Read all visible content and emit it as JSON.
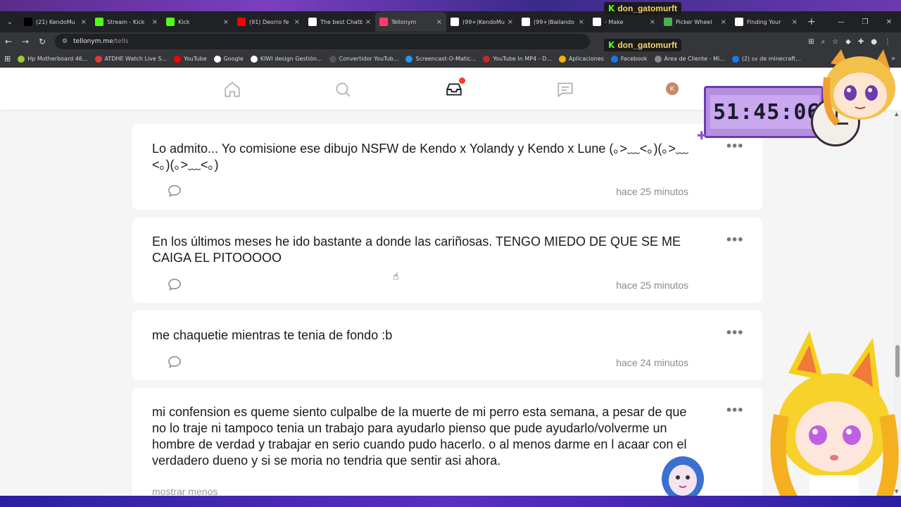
{
  "browser": {
    "tabs": [
      {
        "label": "(21) KendoMu",
        "icon": "x-logo-icon",
        "color": "#000000"
      },
      {
        "label": "Stream - Kick",
        "icon": "kick-logo-icon",
        "color": "#53fc18"
      },
      {
        "label": "Kick",
        "icon": "kick-logo-icon",
        "color": "#53fc18"
      },
      {
        "label": "(91) Deorro fe",
        "icon": "youtube-icon",
        "color": "#ff0000"
      },
      {
        "label": "The best Chatb",
        "icon": "diamond-icon",
        "color": "#ffffff"
      },
      {
        "label": "Tellonym",
        "icon": "tellonym-icon",
        "color": "#ff3c6a"
      },
      {
        "label": "(99+)KendoMu",
        "icon": "tiktok-icon",
        "color": "#ffffff"
      },
      {
        "label": "(99+)Bailando",
        "icon": "tiktok-icon",
        "color": "#ffffff"
      },
      {
        "label": "- Make",
        "icon": "tiktok-icon",
        "color": "#ffffff"
      },
      {
        "label": "Picker Wheel",
        "icon": "wheel-icon",
        "color": "#4caf50"
      },
      {
        "label": "Finding Your",
        "icon": "tiktok-icon",
        "color": "#ffffff"
      }
    ],
    "url_host": "tellonym.me",
    "url_path": "/tells",
    "bookmarks": [
      {
        "label": "Hp Motherboard 46...",
        "color": "#9acd32"
      },
      {
        "label": "ATDHE Watch Live S...",
        "color": "#e53935"
      },
      {
        "label": "YouTube",
        "color": "#ff0000"
      },
      {
        "label": "Google",
        "color": "#ffffff"
      },
      {
        "label": "KIWI design Gestión...",
        "color": "#ffffff"
      },
      {
        "label": "Convertidor YouTub...",
        "color": "#555555"
      },
      {
        "label": "Screencast-O-Matic...",
        "color": "#2196f3"
      },
      {
        "label": "YouTube In MP4 - D...",
        "color": "#c62828"
      },
      {
        "label": "Aplicaciones",
        "color": "#f4b400"
      },
      {
        "label": "Facebook",
        "color": "#1877f2"
      },
      {
        "label": "Área de Cliente - Mi...",
        "color": "#888888"
      },
      {
        "label": "(2) sv de minecraft...",
        "color": "#1877f2"
      }
    ]
  },
  "nav": {
    "avatar_initial": "K",
    "notification_color": "#ff3b30"
  },
  "tells": [
    {
      "text": "Lo admito... Yo comisione ese dibujo NSFW de Kendo x Yolandy y Kendo x Lune (｡>﹏<｡)(｡>﹏<｡)(｡>﹏<｡)",
      "time": "hace 25 minutos"
    },
    {
      "text": "En los últimos meses he ido bastante a donde las cariñosas. TENGO MIEDO DE QUE SE ME CAIGA EL PITOOOOO",
      "time": "hace 25 minutos"
    },
    {
      "text": "me chaquetie mientras te tenia de fondo :b",
      "time": "hace 24 minutos"
    },
    {
      "text": "mi confension es queme siento culpalbe  de la muerte de mi perro esta semana, a pesar de que no lo traje ni tampoco tenia un trabajo para ayudarlo pienso que pude ayudarlo/volverme un hombre de verdad y trabajar en serio cuando pudo hacerlo. o al menos darme en l acaar con el verdadero dueno y si se moria no tendria que sentir asi ahora.",
      "more_label": "mostrar menos"
    }
  ],
  "overlay": {
    "timer": "51:45:06",
    "kick_user_1": "don_gatomurft",
    "kick_user_2": "don_gatomurft"
  }
}
